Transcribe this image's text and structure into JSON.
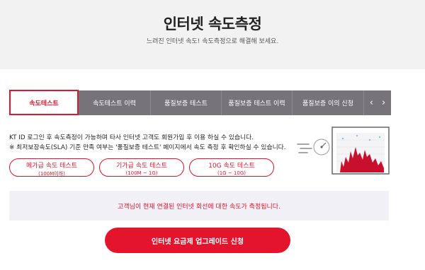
{
  "header": {
    "title": "인터넷 속도측정",
    "subtitle": "느려진 인터넷 속도! 속도측정으로 해결해 보세요."
  },
  "tabs": [
    {
      "label": "속도테스트",
      "active": true
    },
    {
      "label": "속도테스트 이력",
      "active": false
    },
    {
      "label": "품질보증 테스트",
      "active": false
    },
    {
      "label": "품질보증 테스트 이력",
      "active": false
    },
    {
      "label": "품질보증 이의 신청",
      "active": false
    }
  ],
  "tab_nav": {
    "prev": "‹",
    "next": "›"
  },
  "info": {
    "line1": "KT ID 로그인 후 속도측정이 가능하며 타사 인터넷 고객도 회원가입 후 이용 하실 수 있습니다.",
    "line2": "※ 최저보장속도(SLA) 기준 만족 여부는 '품질보증 테스트' 페이지에서 속도 측정 후 확인하실 수 있습니다."
  },
  "speed_tests": [
    {
      "name": "메가급 속도 테스트",
      "range": "(100M이하)"
    },
    {
      "name": "기가급 속도 테스트",
      "range": "(100M ~ 1G)"
    },
    {
      "name": "10G 속도 테스트",
      "range": "(1G ~ 10G)"
    }
  ],
  "notice": "고객님이 현재 연결된 인터넷 회선에 대한 속도가 측정됩니다.",
  "upgrade_button": "인터넷 요금제 업그레이드 신청",
  "colors": {
    "accent": "#e3142b",
    "tab_bg": "#77737a",
    "header_bg": "#f2f2f2",
    "notice_bg": "#f0f0f6"
  }
}
